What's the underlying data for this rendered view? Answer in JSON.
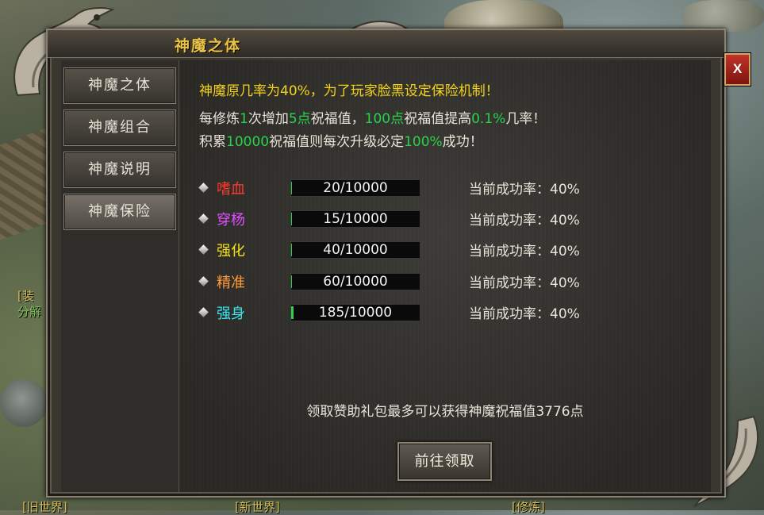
{
  "window": {
    "title": "神魔之体",
    "close_label": "X"
  },
  "sidebar": {
    "items": [
      {
        "label": "神魔之体",
        "active": false
      },
      {
        "label": "神魔组合",
        "active": false
      },
      {
        "label": "神魔说明",
        "active": false
      },
      {
        "label": "神魔保险",
        "active": true
      }
    ]
  },
  "intro": {
    "headline": "神魔原几率为40%，为了玩家脸黑设定保险机制！",
    "line2": [
      "每修炼",
      "1",
      "次增加",
      "5点",
      "祝福值，",
      "100点",
      "祝福值提高",
      "0.1%",
      "几率！"
    ],
    "line3": [
      "积累",
      "10000",
      "祝福值则每次升级必定",
      "100%",
      "成功！"
    ]
  },
  "attributes": [
    {
      "name": "嗜血",
      "color": "#ff3b2f",
      "current": 20,
      "max": 10000,
      "progress_text": "20/10000",
      "rate_text": "当前成功率：40%"
    },
    {
      "name": "穿杨",
      "color": "#e050ff",
      "current": 15,
      "max": 10000,
      "progress_text": "15/10000",
      "rate_text": "当前成功率：40%"
    },
    {
      "name": "强化",
      "color": "#f2e21b",
      "current": 40,
      "max": 10000,
      "progress_text": "40/10000",
      "rate_text": "当前成功率：40%"
    },
    {
      "name": "精准",
      "color": "#ff9a3a",
      "current": 60,
      "max": 10000,
      "progress_text": "60/10000",
      "rate_text": "当前成功率：40%"
    },
    {
      "name": "强身",
      "color": "#38e6f0",
      "current": 185,
      "max": 10000,
      "progress_text": "185/10000",
      "rate_text": "当前成功率：40%"
    }
  ],
  "footer": {
    "note": "领取赞助礼包最多可以获得神魔祝福值3776点",
    "claim_label": "前往领取"
  },
  "background": {
    "labels": [
      "[装",
      "分解",
      "[旧世界]",
      "[新世界]",
      "[修炼]"
    ]
  },
  "colors": {
    "highlight_yellow": "#f2d21b",
    "value_green": "#27d34b",
    "title_gold": "#e7c34a"
  }
}
